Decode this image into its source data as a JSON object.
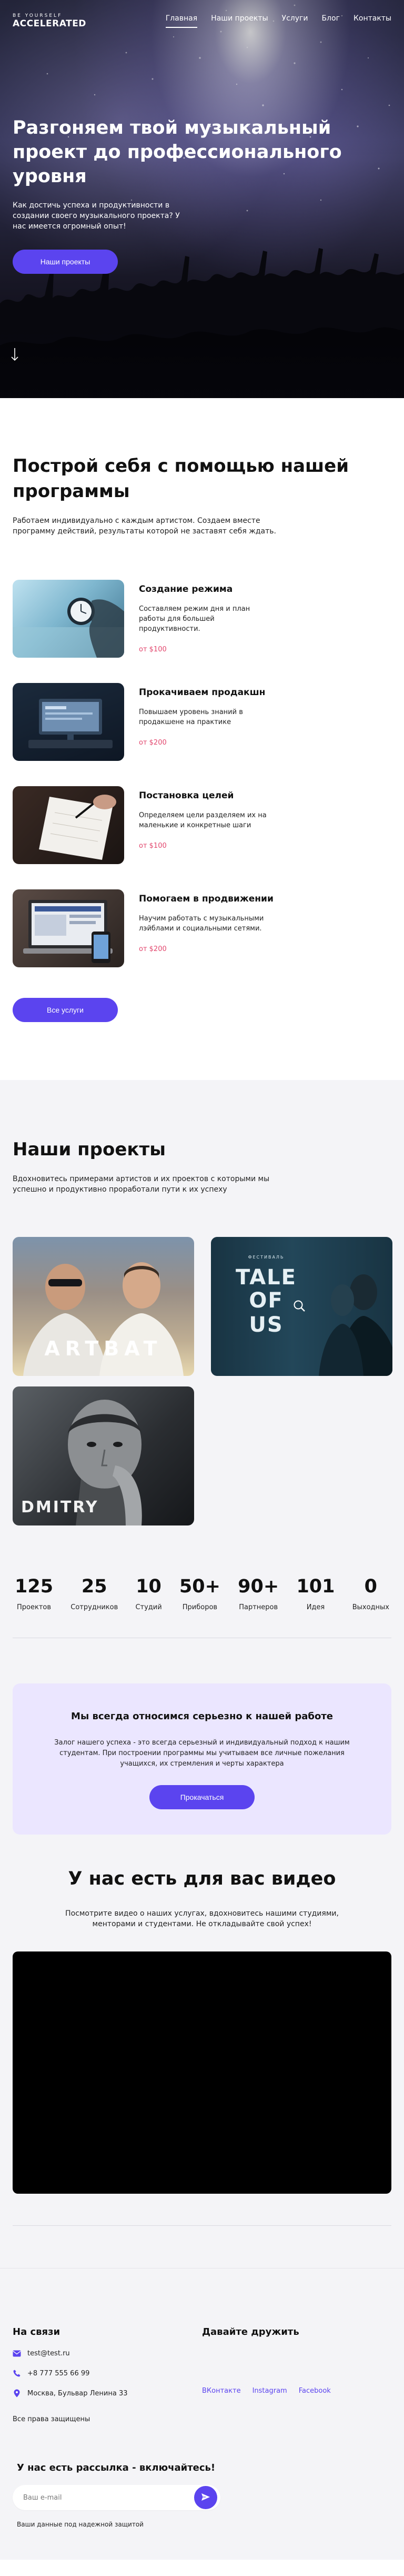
{
  "header": {
    "logo_top": "BE YOURSELF",
    "logo_main": "ACCELERATED",
    "menu": [
      {
        "label": "Главная",
        "active": true
      },
      {
        "label": "Наши проекты",
        "active": false
      },
      {
        "label": "Услуги",
        "active": false
      },
      {
        "label": "Блог",
        "active": false
      },
      {
        "label": "Контакты",
        "active": false
      }
    ]
  },
  "hero": {
    "title": "Разгоняем твой музыкальный проект до профессионального уровня",
    "subtitle": "Как достичь успеха и продуктивности в создании своего музыкального проекта? У нас имеется огромный опыт!",
    "button": "Наши проекты"
  },
  "program": {
    "title": "Построй себя с помощью нашей программы",
    "intro": "Работаем индивидуально с каждым артистом. Создаем вместе программу действий, результаты которой не заставят себя ждать.",
    "services": [
      {
        "name": "Создание режима",
        "desc": "Составляем режим дня и план работы для большей продуктивности.",
        "price": "от $100",
        "image_icon": "clock-icon"
      },
      {
        "name": "Прокачиваем продакшн",
        "desc": "Повышаем уровень знаний в продакшене на практике",
        "price": "от $200",
        "image_icon": "monitor-icon"
      },
      {
        "name": "Постановка целей",
        "desc": "Определяем цели разделяем их на маленькие и конкретные шаги",
        "price": "от $100",
        "image_icon": "notebook-icon"
      },
      {
        "name": "Помогаем в продвижении",
        "desc": "Научим работать с музыкальными лэйблами и социальными сетями.",
        "price": "от $200",
        "image_icon": "laptop-icon"
      }
    ],
    "button": "Все услуги"
  },
  "projects": {
    "title": "Наши проекты",
    "intro": "Вдохновитесь примерами артистов и их проектов с которыми мы успешно и продуктивно проработали пути к их успеху",
    "cards": [
      {
        "caption": "ARTBAT"
      },
      {
        "caption_top": "TALE",
        "caption_bottom": "OF US",
        "mini_text": "ФЕСТИВАЛЬ"
      },
      {
        "caption": "DMITRY"
      }
    ],
    "stats": [
      {
        "num": "125",
        "label": "Проектов"
      },
      {
        "num": "25",
        "label": "Сотрудников"
      },
      {
        "num": "10",
        "label": "Студий"
      },
      {
        "num": "50+",
        "label": "Приборов"
      },
      {
        "num": "90+",
        "label": "Партнеров"
      },
      {
        "num": "101",
        "label": "Идея"
      },
      {
        "num": "0",
        "label": "Выходных"
      }
    ]
  },
  "promise": {
    "title": "Мы всегда относимся серьезно к нашей работе",
    "text": "Залог нашего успеха - это всегда серьезный и индивидуальный подход к нашим студентам. При построении программы мы учитываем все личные пожелания учащихся, их стремления и черты характера",
    "button": "Прокачаться"
  },
  "video": {
    "title": "У нас есть для вас видео",
    "text": "Посмотрите видео о наших услугах, вдохновитесь нашими студиями, менторами и студентами. Не откладывайте свой успех!"
  },
  "footer": {
    "contacts_title": "На связи",
    "email": "test@test.ru",
    "phone": "+8 777 555 66 99",
    "address": "Москва, Бульвар Ленина 33",
    "rights": "Все права защищены",
    "social_title": "Давайте дружить",
    "socials": [
      "ВКонтакте",
      "Instagram",
      "Facebook"
    ],
    "subscribe_title": "У нас есть рассылка - включайтесь!",
    "subscribe_placeholder": "Ваш e-mail",
    "subscribe_note": "Ваши данные под надежной защитой"
  },
  "colors": {
    "accent": "#5b44ef",
    "price": "#e2466d",
    "promise_bg": "#ebe6ff",
    "section_bg": "#f4f4f7"
  }
}
